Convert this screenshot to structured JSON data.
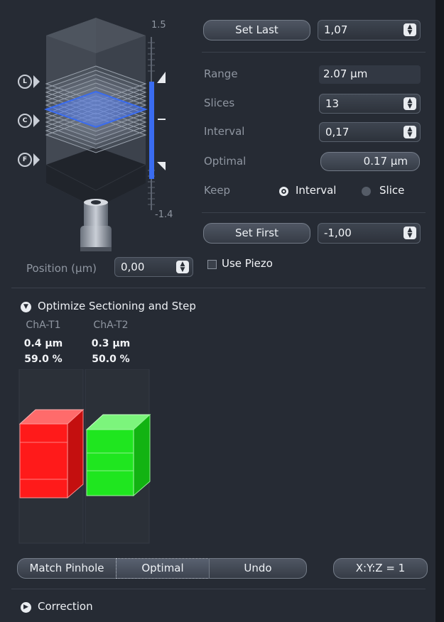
{
  "zstack": {
    "scale_top": "1.5",
    "scale_bottom": "-1.4",
    "markers": {
      "last": "L",
      "center": "C",
      "first": "F"
    }
  },
  "set_last": {
    "label": "Set Last",
    "value": "1,07"
  },
  "range": {
    "label": "Range",
    "value": "2.07 µm"
  },
  "slices": {
    "label": "Slices",
    "value": "13"
  },
  "interval": {
    "label": "Interval",
    "value": "0,17"
  },
  "optimal": {
    "label": "Optimal",
    "button": "0.17 µm"
  },
  "keep": {
    "label": "Keep",
    "option_interval": "Interval",
    "option_slice": "Slice",
    "selected": "Interval"
  },
  "set_first": {
    "label": "Set First",
    "value": "-1,00"
  },
  "position": {
    "label": "Position (µm)",
    "value": "0,00"
  },
  "use_piezo": {
    "label": "Use Piezo",
    "checked": false
  },
  "optimize": {
    "title": "Optimize Sectioning and Step",
    "channels": [
      {
        "name": "ChA-T1",
        "thickness": "0.4 µm",
        "percent": "59.0 %",
        "color": "#ff1a1a"
      },
      {
        "name": "ChA-T2",
        "thickness": "0.3 µm",
        "percent": "50.0 %",
        "color": "#1fe61f"
      }
    ]
  },
  "bottom_bar": {
    "match_pinhole": "Match Pinhole",
    "optimal": "Optimal",
    "undo": "Undo",
    "xyz": "X:Y:Z = 1"
  },
  "correction": {
    "title": "Correction"
  },
  "colors": {
    "accent": "#3a6cf0",
    "panel": "#262b34"
  }
}
